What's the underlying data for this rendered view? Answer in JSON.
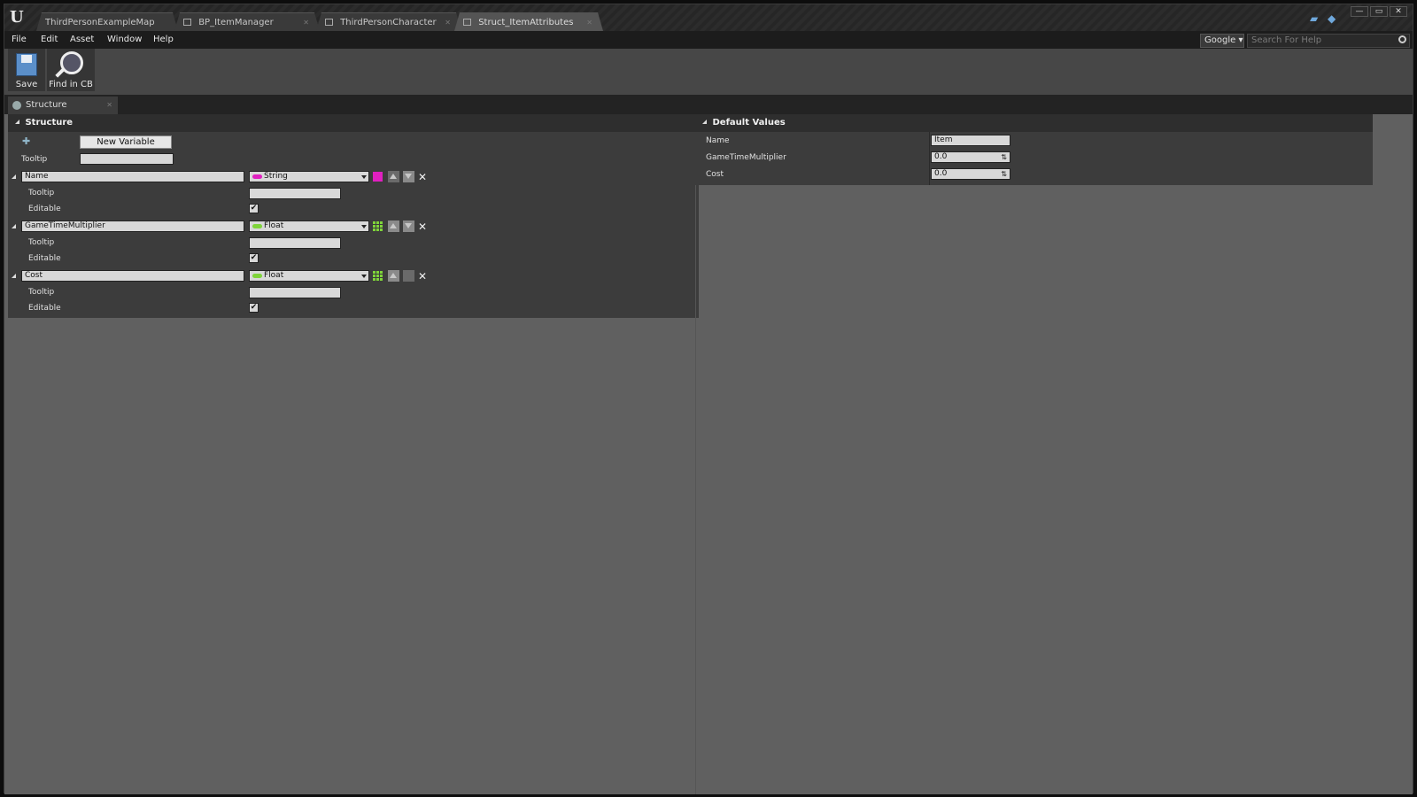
{
  "title_bar": {
    "tabs": [
      {
        "label": "ThirdPersonExampleMap",
        "active": false
      },
      {
        "label": "BP_ItemManager",
        "active": false
      },
      {
        "label": "ThirdPersonCharacter",
        "active": false
      },
      {
        "label": "Struct_ItemAttributes",
        "active": true
      }
    ],
    "window_buttons": {
      "minimize": "—",
      "maximize": "▭",
      "close": "✕"
    }
  },
  "menu": {
    "items": [
      "File",
      "Edit",
      "Asset",
      "Window",
      "Help"
    ],
    "search_provider": "Google",
    "search_placeholder": "Search For Help"
  },
  "toolbar": {
    "save_label": "Save",
    "find_label": "Find in CB"
  },
  "panel_tab": {
    "label": "Structure"
  },
  "structure": {
    "header": "Structure",
    "new_variable_label": "New Variable",
    "tooltip_label": "Tooltip",
    "tooltip_value": "",
    "variables": [
      {
        "name": "Name",
        "type": "String",
        "type_color": "#e020c0",
        "tooltip_label": "Tooltip",
        "tooltip_value": "",
        "editable_label": "Editable",
        "editable": true
      },
      {
        "name": "GameTimeMultiplier",
        "type": "Float",
        "type_color": "#7fd43a",
        "tooltip_label": "Tooltip",
        "tooltip_value": "",
        "editable_label": "Editable",
        "editable": true
      },
      {
        "name": "Cost",
        "type": "Float",
        "type_color": "#7fd43a",
        "tooltip_label": "Tooltip",
        "tooltip_value": "",
        "editable_label": "Editable",
        "editable": true
      }
    ]
  },
  "defaults": {
    "header": "Default Values",
    "rows": [
      {
        "label": "Name",
        "value": "Item"
      },
      {
        "label": "GameTimeMultiplier",
        "value": "0.0"
      },
      {
        "label": "Cost",
        "value": "0.0"
      }
    ]
  },
  "colors": {
    "accent_string": "#e020c0",
    "accent_float": "#7fd43a"
  }
}
